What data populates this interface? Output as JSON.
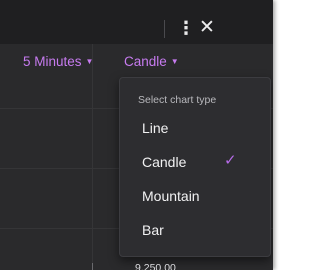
{
  "header": {
    "more_icon": "vertical-ellipsis",
    "more_glyph": "⋮",
    "close_icon": "close",
    "close_glyph": "✕"
  },
  "toolbar": {
    "interval_label": "5 Minutes",
    "chart_type_label": "Candle",
    "caret_glyph": "▼",
    "accent_color": "#c77bf0"
  },
  "chart_type_menu": {
    "header": "Select chart type",
    "items": [
      {
        "label": "Line",
        "selected": false
      },
      {
        "label": "Candle",
        "selected": true
      },
      {
        "label": "Mountain",
        "selected": false
      },
      {
        "label": "Bar",
        "selected": false
      }
    ],
    "check_glyph": "✓"
  },
  "price_axis": {
    "partial_value": "9,250.00"
  }
}
